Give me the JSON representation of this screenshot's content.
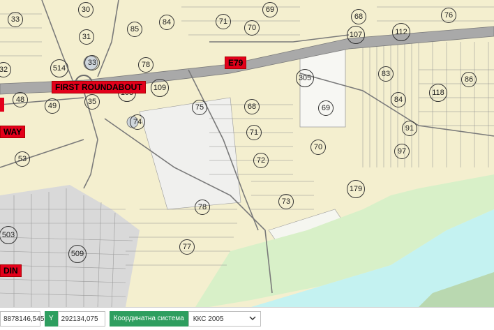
{
  "map": {
    "parcel_numbers": [
      "30",
      "33",
      "31",
      "85",
      "84",
      "69",
      "68",
      "76",
      "71",
      "70",
      "107",
      "112",
      "514",
      "33",
      "78",
      "32",
      "48",
      "49",
      "35",
      "108",
      "109",
      "75",
      "68",
      "305",
      "69",
      "83",
      "84",
      "86",
      "118",
      "91",
      "97",
      "74",
      "71",
      "72",
      "70",
      "53",
      "179",
      "73",
      "78",
      "77",
      "503",
      "509"
    ],
    "road_labels": {
      "e79": "E79",
      "first_roundabout": "FIRST ROUNDABOUT",
      "way": "WAY",
      "din": "DIN"
    },
    "colors": {
      "land": "#f4efcf",
      "highway": "#a9a9a9",
      "river": "#c4f2f1",
      "urban": "#d9d9d9",
      "label_red": "#e3001b"
    }
  },
  "statusbar": {
    "x_value": "8878146,545",
    "y_label": "Y",
    "y_value": "292134,075",
    "crs_label": "Координатна система",
    "crs_value": "ККС 2005"
  }
}
